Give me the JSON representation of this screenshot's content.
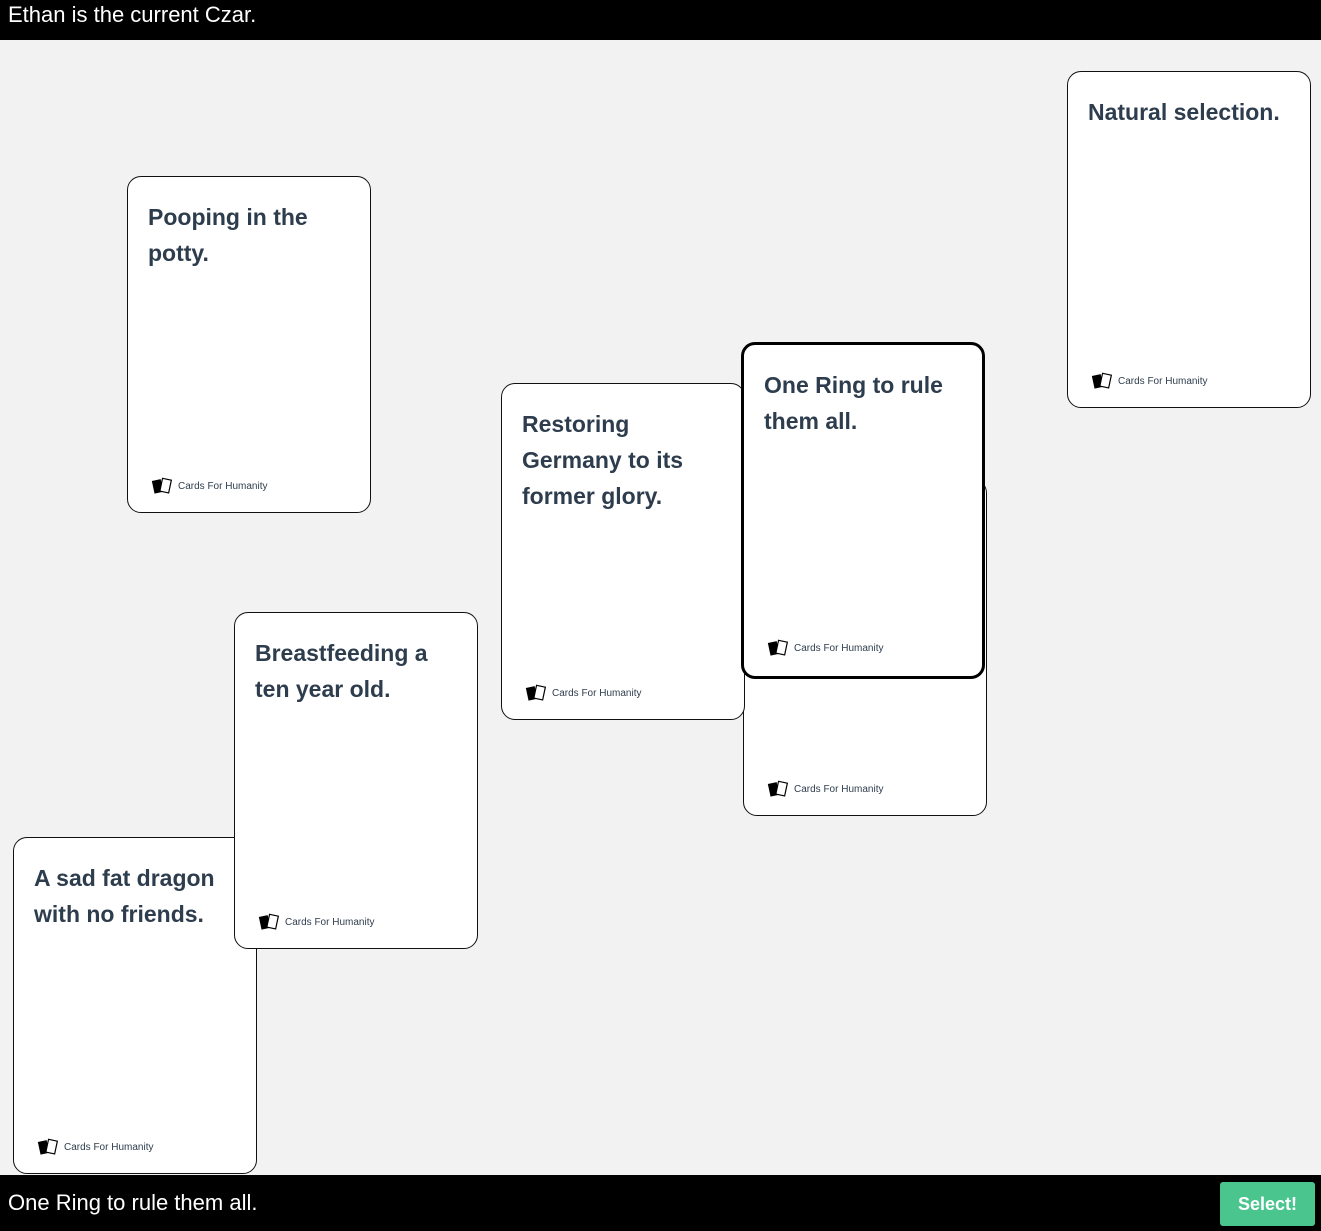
{
  "header": {
    "czar_text": "Ethan is the current Czar."
  },
  "cards": [
    {
      "text": "Natural selection.",
      "brand": "Cards For Humanity"
    },
    {
      "text": "Pooping in the potty.",
      "brand": "Cards For Humanity"
    },
    {
      "text": "",
      "brand": "Cards For Humanity"
    },
    {
      "text": "Restoring Germany to its former glory.",
      "brand": "Cards For Humanity"
    },
    {
      "text": "One Ring to rule them all.",
      "brand": "Cards For Humanity"
    },
    {
      "text": "Breastfeeding a ten year old.",
      "brand": "Cards For Humanity"
    },
    {
      "text": "A sad fat dragon with no friends.",
      "brand": "Cards For Humanity"
    }
  ],
  "selected_card_index": 4,
  "footer": {
    "selected_text": "One Ring to rule them all.",
    "select_label": "Select!"
  },
  "colors": {
    "background": "#f2f2f2",
    "bar": "#000000",
    "card_text": "#2e3d4d",
    "select_button": "#4bc58e"
  },
  "icons": {
    "card_logo": "cards-logo-icon"
  }
}
